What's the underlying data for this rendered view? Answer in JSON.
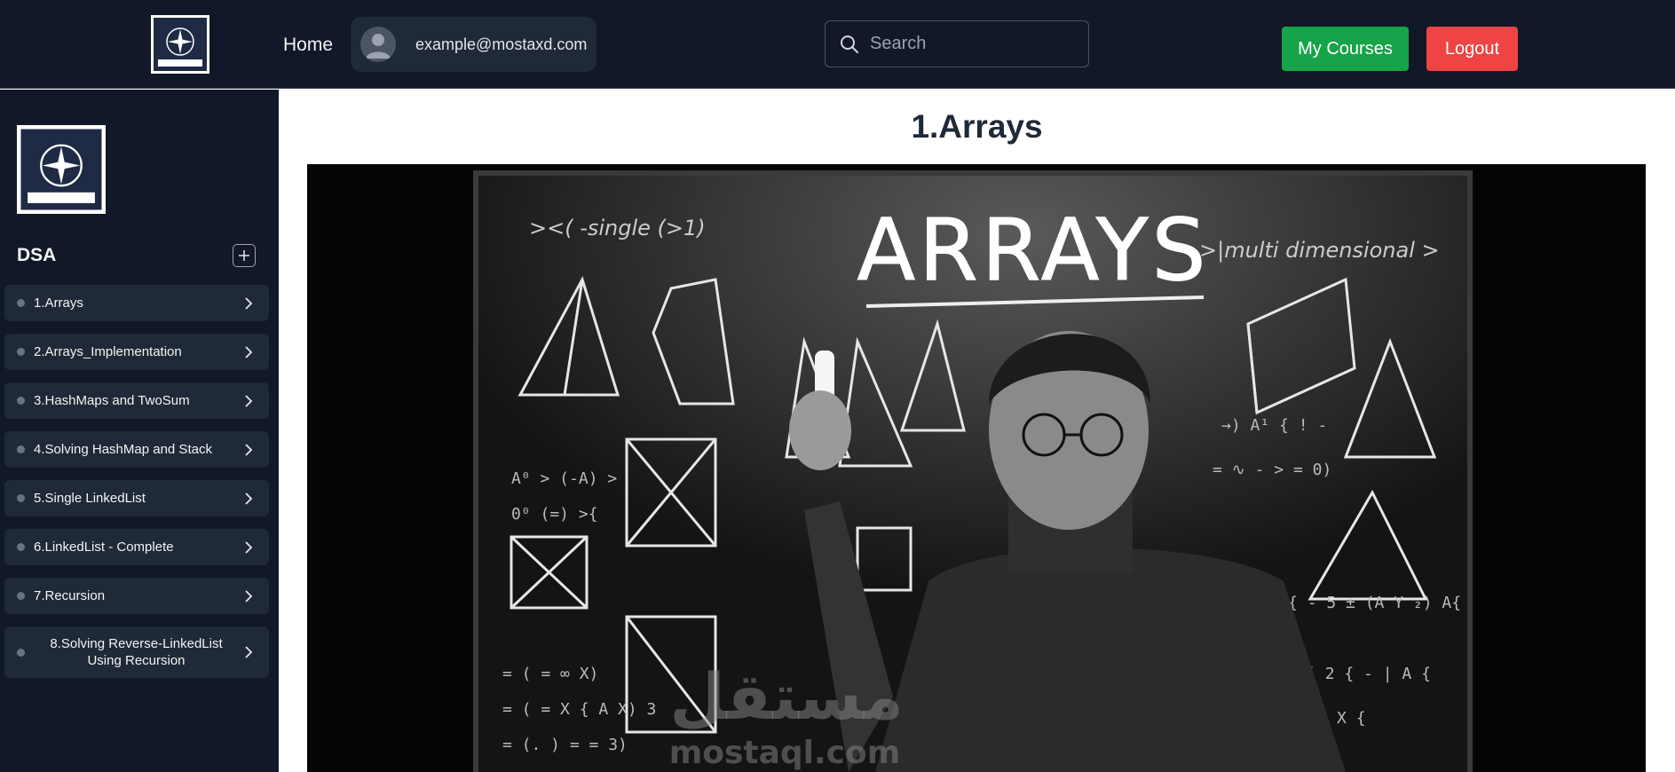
{
  "header": {
    "logo_text": "MOSTA SOFFWAARE",
    "home_label": "Home",
    "user_email": "example@mostaxd.com",
    "search_placeholder": "Search",
    "my_courses_label": "My Courses",
    "logout_label": "Logout"
  },
  "sidebar": {
    "logo_text": "MOSTA SOFFWAARE",
    "course_title": "DSA",
    "lessons": [
      {
        "label": "1.Arrays"
      },
      {
        "label": "2.Arrays_Implementation"
      },
      {
        "label": "3.HashMaps and TwoSum"
      },
      {
        "label": "4.Solving HashMap and Stack"
      },
      {
        "label": "5.Single LinkedList"
      },
      {
        "label": "6.LinkedList - Complete"
      },
      {
        "label": "7.Recursion"
      },
      {
        "label": "8.Solving Reverse-LinkedList Using Recursion"
      }
    ]
  },
  "main": {
    "lesson_title": "1.Arrays",
    "image": {
      "board_title": "ARRAYS",
      "note_left": "><( -single (>1)",
      "note_right": ">|multi dimensional >",
      "watermark_arabic": "مستقل",
      "watermark_latin": "mostaql.com"
    }
  },
  "colors": {
    "nav_bg": "#111827",
    "panel_bg": "#1f2937",
    "green": "#16a34a",
    "red": "#ef4444"
  },
  "icons": [
    "avatar-icon",
    "search-icon",
    "plus-icon",
    "chevron-right-icon",
    "compass-logo-icon"
  ]
}
